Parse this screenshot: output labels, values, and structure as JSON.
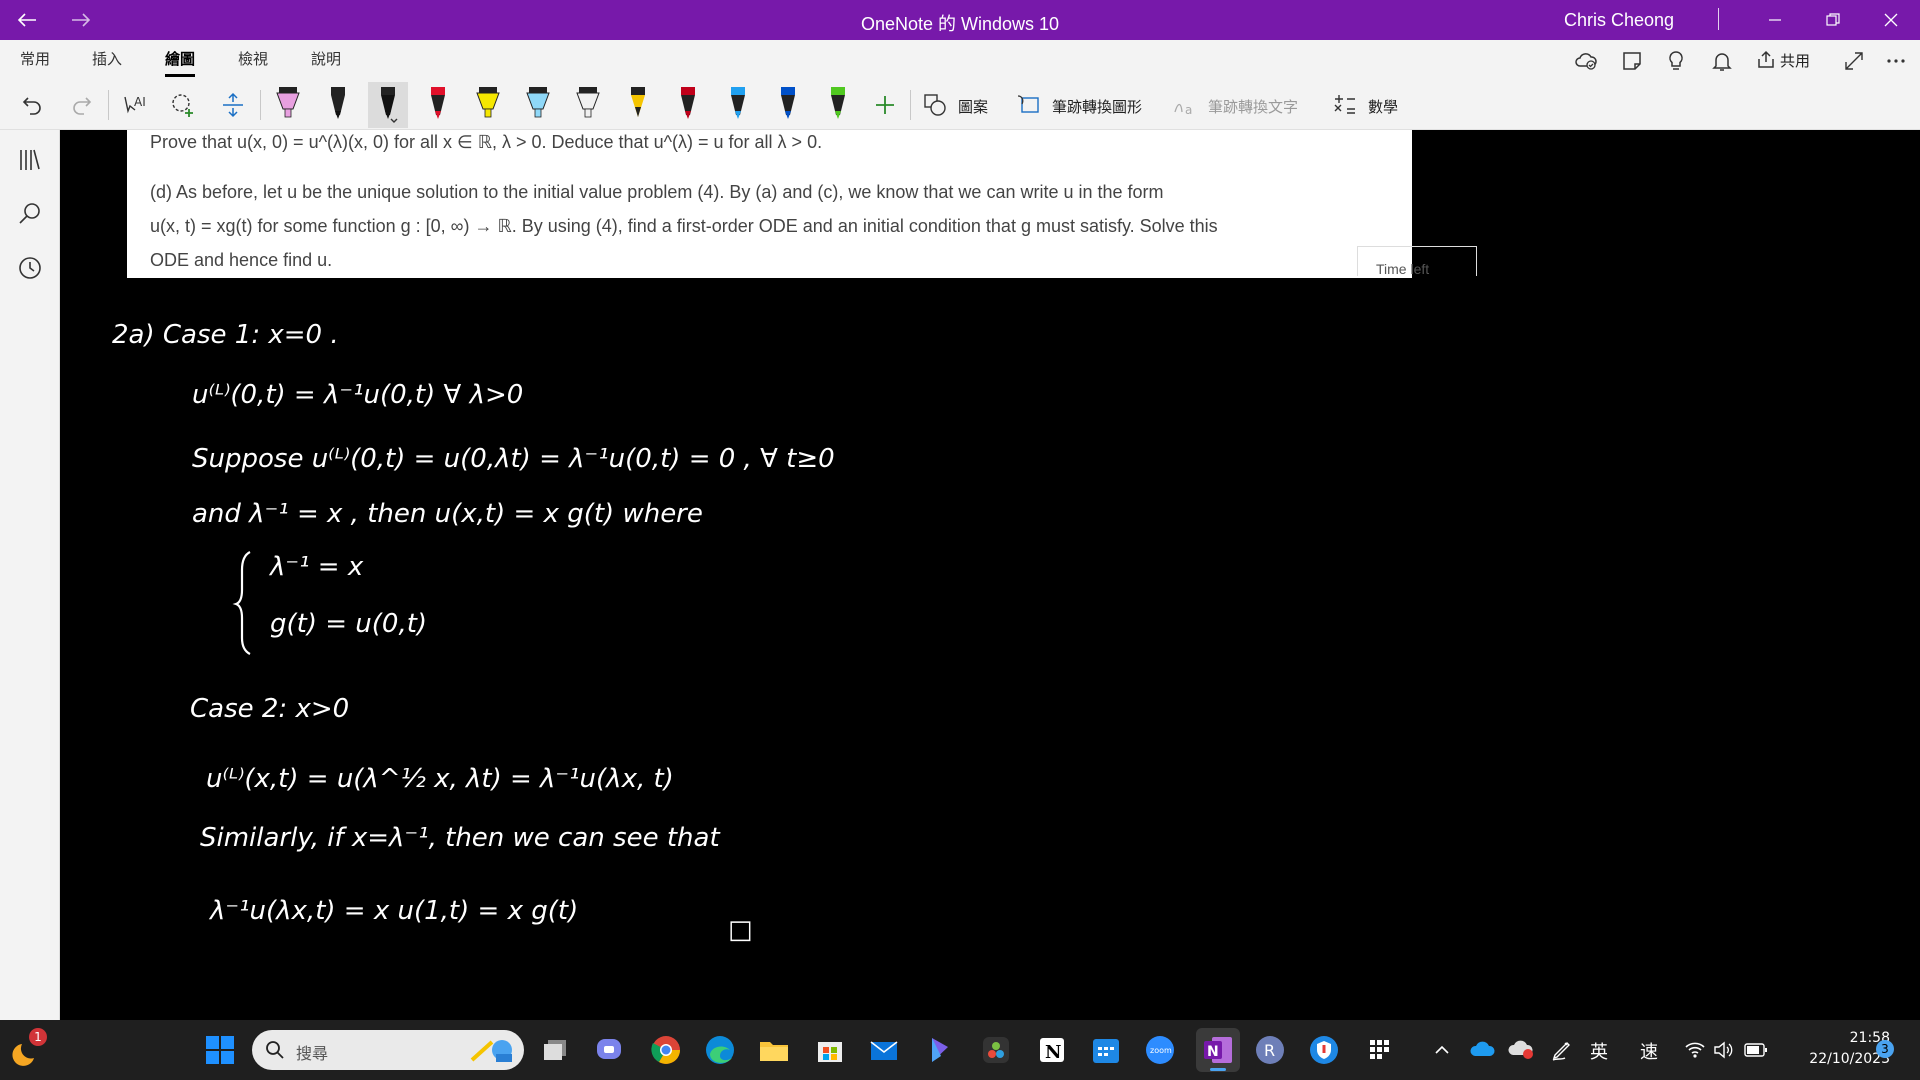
{
  "titlebar": {
    "app_title": "OneNote 的 Windows 10",
    "user_name": "Chris Cheong"
  },
  "ribbon_tabs": [
    "常用",
    "插入",
    "繪圖",
    "檢視",
    "說明"
  ],
  "ribbon_right": {
    "share_label": "共用"
  },
  "toolbar": {
    "shapes_label": "圖案",
    "ink_to_shape_label": "筆跡轉換圖形",
    "ink_to_text_label": "筆跡轉換文字",
    "math_label": "數學",
    "pens": [
      {
        "color": "#E8A0E0",
        "type": "highlighter"
      },
      {
        "color": "#111111",
        "type": "pen"
      },
      {
        "color": "#111111",
        "type": "pen-selected"
      },
      {
        "color": "#E0102A",
        "type": "pen"
      },
      {
        "color": "#F5E700",
        "type": "highlighter"
      },
      {
        "color": "#8FD8F8",
        "type": "highlighter"
      },
      {
        "color": "#F0F0F0",
        "type": "highlighter"
      },
      {
        "color": "#F5C400",
        "type": "pencil"
      },
      {
        "color": "#C0001A",
        "type": "pen"
      },
      {
        "color": "#20A0F0",
        "type": "pen"
      },
      {
        "color": "#0050C8",
        "type": "pen"
      },
      {
        "color": "#50C820",
        "type": "pen"
      }
    ]
  },
  "pasted_text": {
    "line1": "Prove that u(x, 0) = u^(λ)(x, 0) for all x ∈ ℝ, λ > 0. Deduce that u^(λ) = u for all λ > 0.",
    "line2": "(d) As before, let u be the unique solution to the initial value problem (4). By (a) and (c), we know that we can write u in the form",
    "line3": "u(x, t) = xg(t) for some function g : [0, ∞) → ℝ. By using (4), find a first-order ODE and an initial condition that g must satisfy. Solve this",
    "line4": "ODE and hence find u.",
    "time_left": "Time left"
  },
  "ink_notes": {
    "l1": "2a)  Case 1:  x=0 .",
    "l2": "u⁽ᴸ⁾(0,t) = λ⁻¹u(0,t)  ∀ λ>0",
    "l3": "Suppose u⁽ᴸ⁾(0,t) = u(0,λt) = λ⁻¹u(0,t) = 0 ,  ∀ t≥0",
    "l4": "and  λ⁻¹ = x , then  u(x,t) = x g(t)  where",
    "l5": "λ⁻¹ = x",
    "l6": "g(t) = u(0,t)",
    "l7": "Case 2:  x>0",
    "l8": "u⁽ᴸ⁾(x,t) = u(λ^½ x, λt) = λ⁻¹u(λx, t)",
    "l9": "Similarly, if x=λ⁻¹, then we can see that",
    "l10": "λ⁻¹u(λx,t) =  x u(1,t)  = x g(t)",
    "qed": "□"
  },
  "taskbar": {
    "search_placeholder": "搜尋",
    "notification_badge": "1",
    "tray_ime1": "英",
    "tray_ime2": "速",
    "time": "21:58",
    "date": "22/10/2023",
    "notifications_count": "3"
  },
  "colors": {
    "accent": "#7719AA",
    "ink": "#FFFFFF",
    "canvas": "#000000"
  }
}
